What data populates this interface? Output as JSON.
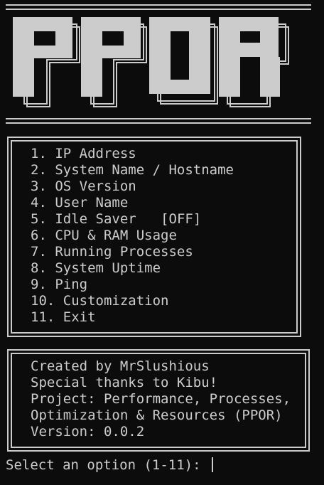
{
  "banner": {
    "logo_text": "PPOR"
  },
  "menu": {
    "items": [
      {
        "number": "1.",
        "label": "IP Address"
      },
      {
        "number": "2.",
        "label": "System Name / Hostname"
      },
      {
        "number": "3.",
        "label": "OS Version"
      },
      {
        "number": "4.",
        "label": "User Name"
      },
      {
        "number": "5.",
        "label": "Idle Saver",
        "status": "[OFF]"
      },
      {
        "number": "6.",
        "label": "CPU & RAM Usage"
      },
      {
        "number": "7.",
        "label": "Running Processes"
      },
      {
        "number": "8.",
        "label": "System Uptime"
      },
      {
        "number": "9.",
        "label": "Ping"
      },
      {
        "number": "10.",
        "label": "Customization"
      },
      {
        "number": "11.",
        "label": "Exit"
      }
    ]
  },
  "info": {
    "lines": [
      "Created by MrSlushious",
      "Special thanks to Kibu!",
      "Project: Performance, Processes,",
      "Optimization & Resources (PPOR)",
      "Version: 0.0.2"
    ]
  },
  "prompt": {
    "text": "Select an option (1-11): "
  },
  "colors": {
    "background": "#0c0c0c",
    "foreground": "#cccccc"
  }
}
